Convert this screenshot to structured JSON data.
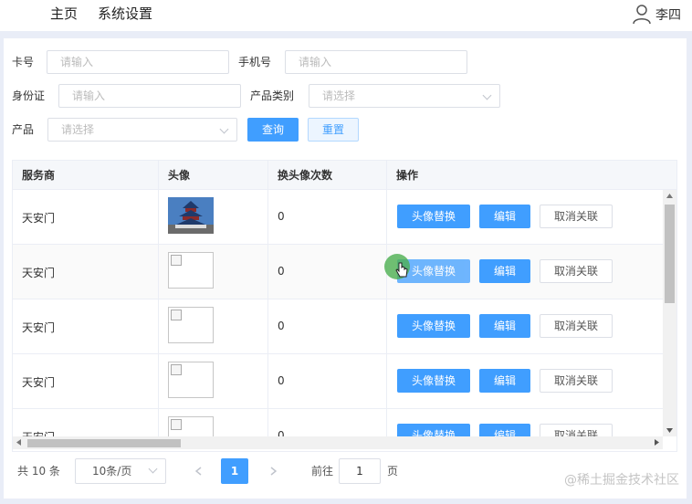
{
  "nav": {
    "home": "主页",
    "settings": "系统设置"
  },
  "user": {
    "name": "李四",
    "icon": "user-icon"
  },
  "filters": {
    "card_label": "卡号",
    "card_placeholder": "请输入",
    "phone_label": "手机号",
    "phone_placeholder": "请输入",
    "id_label": "身份证",
    "id_placeholder": "请输入",
    "category_label": "产品类别",
    "category_placeholder": "请选择",
    "product_label": "产品",
    "product_placeholder": "请选择",
    "search_button": "查询",
    "reset_button": "重置"
  },
  "table": {
    "headers": [
      "服务商",
      "头像",
      "换头像次数",
      "操作"
    ],
    "rows": [
      {
        "provider": "天安门",
        "count": "0",
        "has_image": true
      },
      {
        "provider": "天安门",
        "count": "0",
        "has_image": false
      },
      {
        "provider": "天安门",
        "count": "0",
        "has_image": false
      },
      {
        "provider": "天安门",
        "count": "0",
        "has_image": false
      },
      {
        "provider": "天安门",
        "count": "0",
        "has_image": false
      }
    ],
    "actions": {
      "replace": "头像替换",
      "edit": "编辑",
      "unlink": "取消关联"
    }
  },
  "pagination": {
    "total": "共 10 条",
    "page_size": "10条/页",
    "current_page": "1",
    "goto_label": "前往",
    "goto_value": "1",
    "page_suffix": "页"
  },
  "watermark": "@稀土掘金技术社区",
  "colors": {
    "primary": "#409eff",
    "background": "#e9edf7"
  }
}
